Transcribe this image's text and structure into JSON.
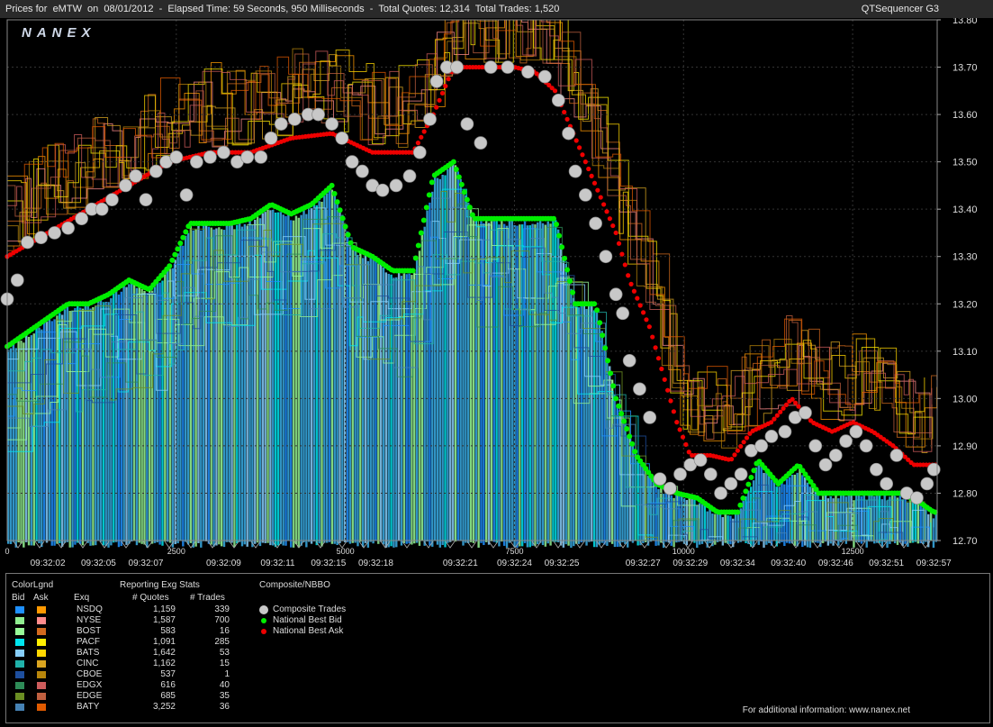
{
  "header": {
    "title": "Prices for  eMTW  on  08/01/2012  -  Elapsed Time: 59 Seconds, 950 Milliseconds  -  Total Quotes: 12,314  Total Trades: 1,520",
    "app_name": "QTSequencer G3",
    "watermark": "NANEX"
  },
  "chart_data": {
    "type": "scatter",
    "y_axis": {
      "min": 12.7,
      "max": 13.8,
      "ticks": [
        "13.80",
        "13.70",
        "13.60",
        "13.50",
        "13.40",
        "13.30",
        "13.20",
        "13.10",
        "13.00",
        "12.90",
        "12.80",
        "12.70"
      ]
    },
    "x_axis": {
      "min": 0,
      "max": 13750,
      "count_ticks": [
        0,
        2500,
        5000,
        7500,
        10000,
        12500
      ],
      "time_labels": [
        {
          "x": 600,
          "t": "09:32:02"
        },
        {
          "x": 1350,
          "t": "09:32:05"
        },
        {
          "x": 2050,
          "t": "09:32:07"
        },
        {
          "x": 3200,
          "t": "09:32:09"
        },
        {
          "x": 4000,
          "t": "09:32:11"
        },
        {
          "x": 4750,
          "t": "09:32:15"
        },
        {
          "x": 5450,
          "t": "09:32:18"
        },
        {
          "x": 6700,
          "t": "09:32:21"
        },
        {
          "x": 7500,
          "t": "09:32:24"
        },
        {
          "x": 8200,
          "t": "09:32:25"
        },
        {
          "x": 9400,
          "t": "09:32:27"
        },
        {
          "x": 10100,
          "t": "09:32:29"
        },
        {
          "x": 10800,
          "t": "09:32:34"
        },
        {
          "x": 11550,
          "t": "09:32:40"
        },
        {
          "x": 12250,
          "t": "09:32:46"
        },
        {
          "x": 13000,
          "t": "09:32:51"
        },
        {
          "x": 13700,
          "t": "09:32:57"
        }
      ]
    },
    "series": [
      {
        "name": "Composite Trades",
        "color": "#c8c8c8",
        "points": [
          [
            0,
            13.21
          ],
          [
            150,
            13.25
          ],
          [
            300,
            13.33
          ],
          [
            500,
            13.34
          ],
          [
            700,
            13.35
          ],
          [
            900,
            13.36
          ],
          [
            1100,
            13.38
          ],
          [
            1250,
            13.4
          ],
          [
            1400,
            13.4
          ],
          [
            1550,
            13.42
          ],
          [
            1750,
            13.45
          ],
          [
            1900,
            13.47
          ],
          [
            2050,
            13.42
          ],
          [
            2200,
            13.48
          ],
          [
            2350,
            13.5
          ],
          [
            2500,
            13.51
          ],
          [
            2650,
            13.43
          ],
          [
            2800,
            13.5
          ],
          [
            3000,
            13.51
          ],
          [
            3200,
            13.52
          ],
          [
            3400,
            13.5
          ],
          [
            3550,
            13.51
          ],
          [
            3750,
            13.51
          ],
          [
            3900,
            13.55
          ],
          [
            4050,
            13.58
          ],
          [
            4250,
            13.59
          ],
          [
            4450,
            13.6
          ],
          [
            4600,
            13.6
          ],
          [
            4800,
            13.58
          ],
          [
            4950,
            13.55
          ],
          [
            5100,
            13.5
          ],
          [
            5250,
            13.48
          ],
          [
            5400,
            13.45
          ],
          [
            5550,
            13.44
          ],
          [
            5750,
            13.45
          ],
          [
            5950,
            13.47
          ],
          [
            6100,
            13.52
          ],
          [
            6250,
            13.59
          ],
          [
            6350,
            13.67
          ],
          [
            6500,
            13.7
          ],
          [
            6650,
            13.7
          ],
          [
            6800,
            13.58
          ],
          [
            7000,
            13.54
          ],
          [
            7150,
            13.7
          ],
          [
            7400,
            13.7
          ],
          [
            7700,
            13.69
          ],
          [
            7950,
            13.68
          ],
          [
            8150,
            13.63
          ],
          [
            8300,
            13.56
          ],
          [
            8400,
            13.48
          ],
          [
            8550,
            13.43
          ],
          [
            8700,
            13.37
          ],
          [
            8850,
            13.3
          ],
          [
            9000,
            13.22
          ],
          [
            9100,
            13.18
          ],
          [
            9200,
            13.08
          ],
          [
            9350,
            13.02
          ],
          [
            9500,
            12.96
          ],
          [
            9650,
            12.83
          ],
          [
            9800,
            12.81
          ],
          [
            9950,
            12.84
          ],
          [
            10100,
            12.86
          ],
          [
            10250,
            12.87
          ],
          [
            10400,
            12.84
          ],
          [
            10550,
            12.8
          ],
          [
            10700,
            12.82
          ],
          [
            10850,
            12.84
          ],
          [
            11000,
            12.89
          ],
          [
            11150,
            12.9
          ],
          [
            11300,
            12.92
          ],
          [
            11500,
            12.93
          ],
          [
            11650,
            12.96
          ],
          [
            11800,
            12.97
          ],
          [
            11950,
            12.9
          ],
          [
            12100,
            12.86
          ],
          [
            12250,
            12.88
          ],
          [
            12400,
            12.91
          ],
          [
            12550,
            12.93
          ],
          [
            12700,
            12.9
          ],
          [
            12850,
            12.85
          ],
          [
            13000,
            12.82
          ],
          [
            13150,
            12.88
          ],
          [
            13300,
            12.8
          ],
          [
            13450,
            12.79
          ],
          [
            13600,
            12.82
          ],
          [
            13700,
            12.85
          ]
        ]
      },
      {
        "name": "National Best Bid",
        "color": "#00ee00",
        "points": [
          [
            0,
            13.11
          ],
          [
            300,
            13.14
          ],
          [
            600,
            13.17
          ],
          [
            900,
            13.2
          ],
          [
            1200,
            13.2
          ],
          [
            1500,
            13.22
          ],
          [
            1800,
            13.25
          ],
          [
            2100,
            13.23
          ],
          [
            2400,
            13.28
          ],
          [
            2700,
            13.37
          ],
          [
            3000,
            13.37
          ],
          [
            3300,
            13.37
          ],
          [
            3600,
            13.38
          ],
          [
            3900,
            13.41
          ],
          [
            4200,
            13.39
          ],
          [
            4500,
            13.41
          ],
          [
            4800,
            13.45
          ],
          [
            5100,
            13.32
          ],
          [
            5400,
            13.3
          ],
          [
            5700,
            13.27
          ],
          [
            6000,
            13.27
          ],
          [
            6300,
            13.47
          ],
          [
            6600,
            13.5
          ],
          [
            6900,
            13.38
          ],
          [
            7200,
            13.38
          ],
          [
            7500,
            13.38
          ],
          [
            7800,
            13.38
          ],
          [
            8100,
            13.38
          ],
          [
            8400,
            13.2
          ],
          [
            8700,
            13.2
          ],
          [
            9000,
            13.0
          ],
          [
            9300,
            12.88
          ],
          [
            9600,
            12.82
          ],
          [
            9900,
            12.8
          ],
          [
            10200,
            12.79
          ],
          [
            10500,
            12.76
          ],
          [
            10800,
            12.76
          ],
          [
            11100,
            12.87
          ],
          [
            11400,
            12.82
          ],
          [
            11700,
            12.86
          ],
          [
            12000,
            12.8
          ],
          [
            12300,
            12.8
          ],
          [
            12600,
            12.8
          ],
          [
            12900,
            12.8
          ],
          [
            13200,
            12.8
          ],
          [
            13500,
            12.78
          ],
          [
            13700,
            12.76
          ]
        ]
      },
      {
        "name": "National Best Ask",
        "color": "#ee0000",
        "points": [
          [
            0,
            13.3
          ],
          [
            600,
            13.35
          ],
          [
            1200,
            13.4
          ],
          [
            1800,
            13.45
          ],
          [
            2400,
            13.5
          ],
          [
            3000,
            13.52
          ],
          [
            3600,
            13.52
          ],
          [
            4200,
            13.55
          ],
          [
            4800,
            13.56
          ],
          [
            5400,
            13.52
          ],
          [
            6000,
            13.52
          ],
          [
            6300,
            13.6
          ],
          [
            6600,
            13.7
          ],
          [
            6900,
            13.7
          ],
          [
            7200,
            13.7
          ],
          [
            7500,
            13.7
          ],
          [
            7800,
            13.69
          ],
          [
            8100,
            13.65
          ],
          [
            8400,
            13.55
          ],
          [
            8700,
            13.45
          ],
          [
            9000,
            13.35
          ],
          [
            9200,
            13.25
          ],
          [
            9500,
            13.15
          ],
          [
            9700,
            13.05
          ],
          [
            9900,
            12.95
          ],
          [
            10100,
            12.88
          ],
          [
            10400,
            12.88
          ],
          [
            10700,
            12.87
          ],
          [
            11000,
            12.93
          ],
          [
            11300,
            12.95
          ],
          [
            11600,
            13.0
          ],
          [
            11900,
            12.95
          ],
          [
            12200,
            12.93
          ],
          [
            12500,
            12.95
          ],
          [
            12800,
            12.93
          ],
          [
            13100,
            12.9
          ],
          [
            13400,
            12.86
          ],
          [
            13700,
            12.86
          ]
        ]
      }
    ],
    "bid_fill_color": "#3aaee8",
    "legend_title": "Composite/NBBO",
    "legend": [
      {
        "label": "Composite Trades",
        "color": "#c8c8c8"
      },
      {
        "label": "National Best Bid",
        "color": "#00ee00"
      },
      {
        "label": "National Best Ask",
        "color": "#ee0000"
      }
    ]
  },
  "legend_panel": {
    "color_legend_title": "ColorLgnd",
    "bid_header": "Bid",
    "ask_header": "Ask",
    "exq_header": "Exq",
    "stats_title": "Reporting Exg Stats",
    "quotes_header": "# Quotes",
    "trades_header": "# Trades",
    "exchanges": [
      {
        "name": "NSDQ",
        "quotes": "1,159",
        "trades": "339",
        "bid_color": "#1e90ff",
        "ask_color": "#ff9900"
      },
      {
        "name": "NYSE",
        "quotes": "1,587",
        "trades": "700",
        "bid_color": "#90ee90",
        "ask_color": "#ff8c8c"
      },
      {
        "name": "BOST",
        "quotes": "583",
        "trades": "16",
        "bid_color": "#98fb98",
        "ask_color": "#d2691e"
      },
      {
        "name": "PACF",
        "quotes": "1,091",
        "trades": "285",
        "bid_color": "#00e5ee",
        "ask_color": "#ffee00"
      },
      {
        "name": "BATS",
        "quotes": "1,642",
        "trades": "53",
        "bid_color": "#87cefa",
        "ask_color": "#ffd700"
      },
      {
        "name": "CINC",
        "quotes": "1,162",
        "trades": "15",
        "bid_color": "#20b2aa",
        "ask_color": "#daa520"
      },
      {
        "name": "CBOE",
        "quotes": "537",
        "trades": "1",
        "bid_color": "#1e4f9e",
        "ask_color": "#b8860b"
      },
      {
        "name": "EDGX",
        "quotes": "616",
        "trades": "40",
        "bid_color": "#2e8b57",
        "ask_color": "#cd5c5c"
      },
      {
        "name": "EDGE",
        "quotes": "685",
        "trades": "35",
        "bid_color": "#6b8e23",
        "ask_color": "#c06040"
      },
      {
        "name": "BATY",
        "quotes": "3,252",
        "trades": "36",
        "bid_color": "#4682b4",
        "ask_color": "#e05a00"
      }
    ],
    "footer": "For additional information: www.nanex.net"
  }
}
